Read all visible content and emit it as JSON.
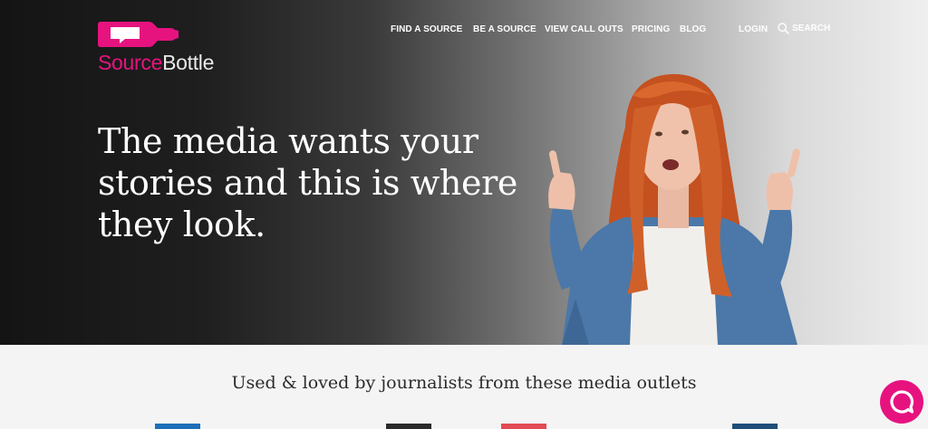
{
  "brand": {
    "name_part1": "Source",
    "name_part2": "Bottle",
    "accent": "#e6137f"
  },
  "nav": {
    "find_source": "FIND A SOURCE",
    "be_source": "BE A SOURCE",
    "view_call_outs": "VIEW CALL OUTS",
    "pricing": "PRICING",
    "blog": "BLOG",
    "login": "LOGIN",
    "search": "SEARCH",
    "search_icon": "search-icon"
  },
  "hero": {
    "headline": "The media wants your stories and this is where they look."
  },
  "media_band": {
    "title": "Used & loved by journalists from these media outlets",
    "outlet_colors": [
      "#1c6fb8",
      "#2a2a2a",
      "#e24a54",
      "#1f4e7a"
    ]
  },
  "chat": {
    "icon": "chat-bubble-icon",
    "color": "#e6137f"
  }
}
